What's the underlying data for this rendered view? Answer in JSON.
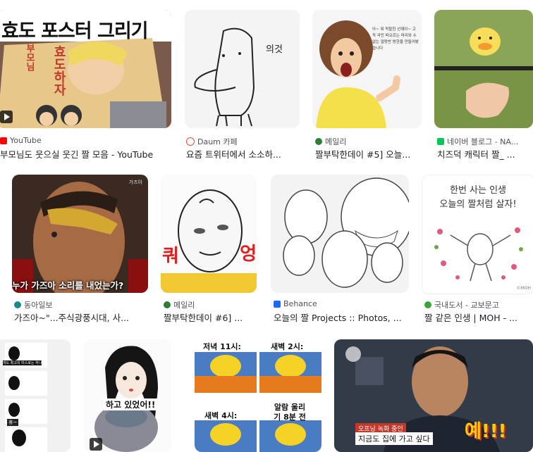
{
  "colors": {
    "youtube": "#ff0000",
    "daum": "#e74c3c",
    "naver": "#03c75a",
    "donga": "#1a8a8a",
    "behance": "#1769ff",
    "kyobo": "#3aa63a",
    "mailly": "#2e7d32"
  },
  "row1": [
    {
      "overlay": "효도 포스터 그리기",
      "poster1": "부모님",
      "poster2": "효도하자",
      "source": "YouTube",
      "title": "부모님도 웃으실 웃긴 짤 모음 - YouTube"
    },
    {
      "overlay": "의것",
      "source": "Daum 카페",
      "title": "요즘 트위터에서 소소하..."
    },
    {
      "speech": "아~ 뭐 착할한 선재야~ 고작 국민 떠오르는 머리와 수 없는 얼랑반 방한을 만들어봤습니다",
      "source": "메일리",
      "title": "짤부탁한데이 #5] 오늘..."
    },
    {
      "source": "네이버 블로그 - NA...",
      "title": "치즈덕 캐릭터 짤_ ..."
    }
  ],
  "row2": [
    {
      "caption": "누가 가즈아 소리를 내었는가?",
      "tag": "가즈아",
      "source": "동아일보",
      "title": "가즈아~\"...주식광풍시대, 사..."
    },
    {
      "left": "쿼",
      "right": "엉",
      "source": "메일리",
      "title": "짤부탁한데이 #6] ..."
    },
    {
      "source": "Behance",
      "title": "오늘의 짤 Projects :: Photos, ..."
    },
    {
      "line1": "한번 사는 인생",
      "line2": "오늘의 짤처럼 살자!",
      "mark": "©MOH",
      "source": "국내도서 - 교보문고",
      "title": "짤 같은 인생 | MOH - ..."
    }
  ],
  "row3": [
    {
      "texts": [
        "개도 최고의 미스로는 하나",
        "",
        "휴~"
      ]
    },
    {
      "caption": "하고 있었어!!"
    },
    {
      "t1": "저녁 11시:",
      "t2": "새벽 2시:",
      "t3": "새벽 4시:",
      "t4": "알람 울리기 8분 전"
    },
    {
      "badge": "오프닝 녹화 중인",
      "caption": "지금도 집에 가고 싶다",
      "shout": "예!!!"
    }
  ]
}
